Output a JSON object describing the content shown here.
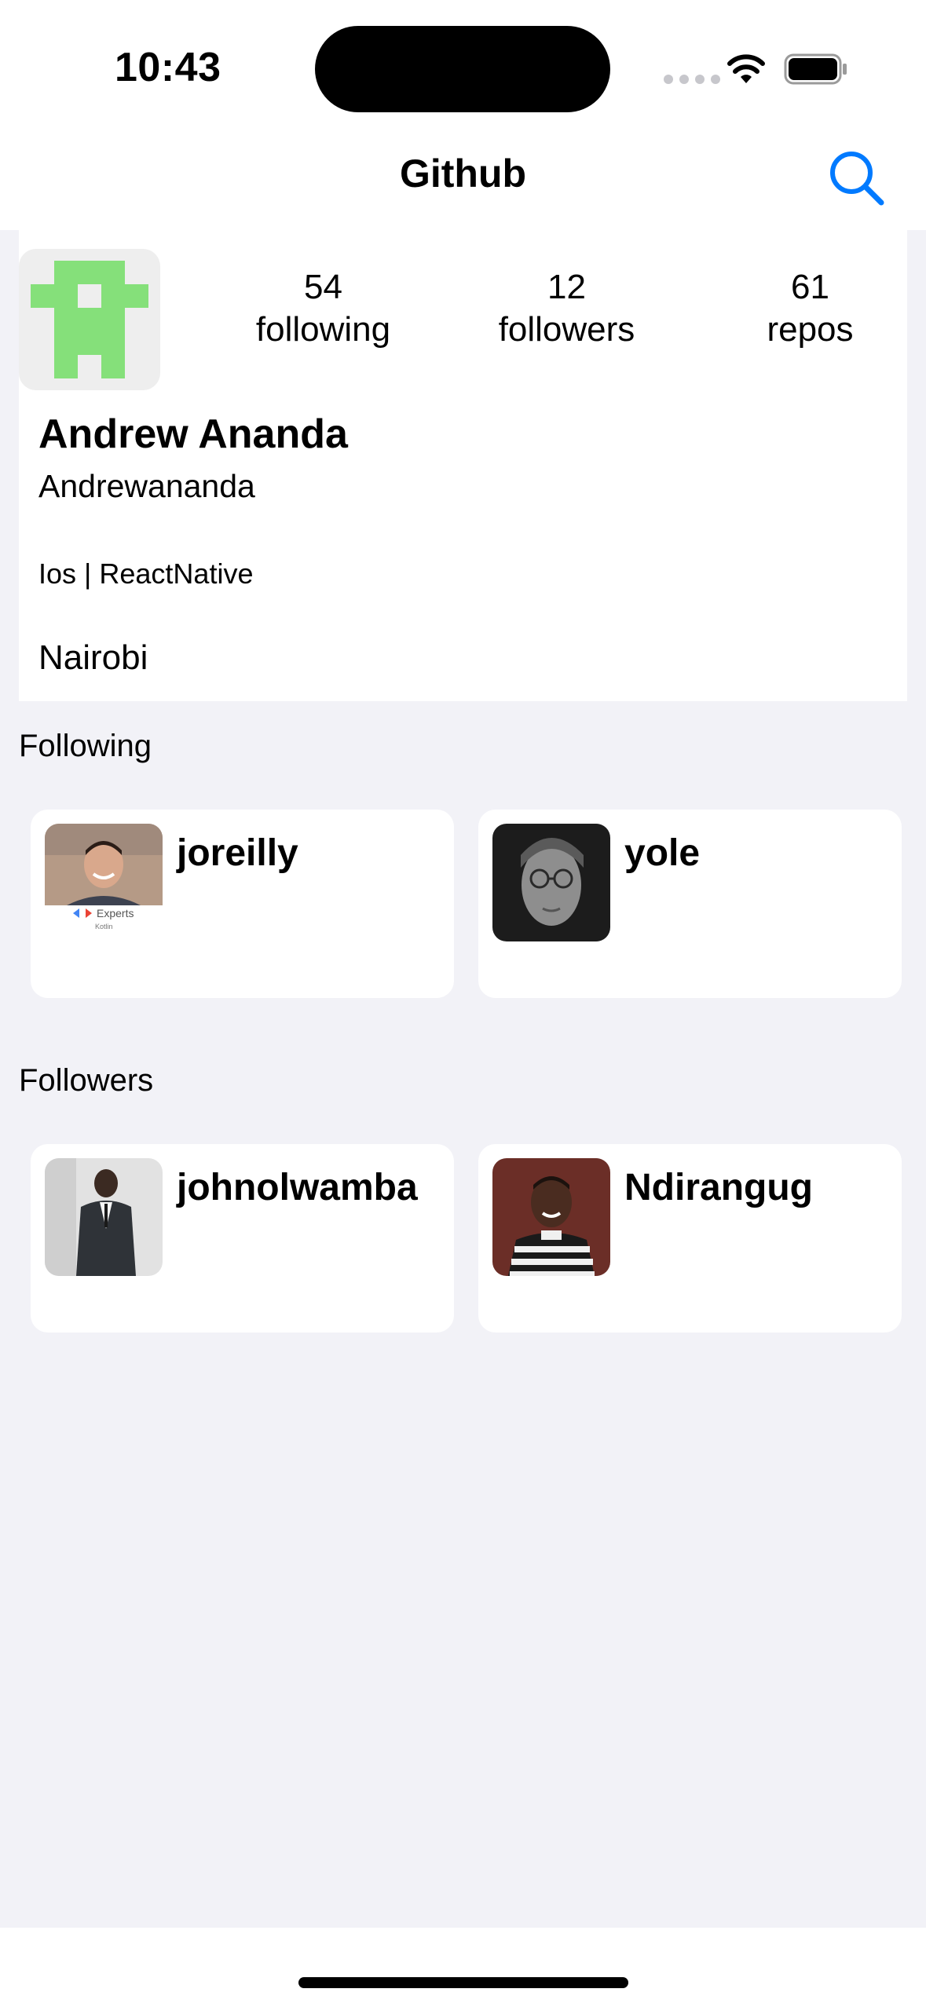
{
  "status_bar": {
    "time": "10:43"
  },
  "nav": {
    "title": "Github",
    "search_icon": "search-icon"
  },
  "profile": {
    "avatar_icon": "identicon",
    "avatar_color": "#85e07a",
    "stats": {
      "following_count": "54",
      "following_label": "following",
      "followers_count": "12",
      "followers_label": "followers",
      "repos_count": "61",
      "repos_label": "repos"
    },
    "name": "Andrew Ananda",
    "login": "Andrewananda",
    "bio": "Ios | ReactNative",
    "location": "Nairobi"
  },
  "following": {
    "title": "Following",
    "users": [
      {
        "name": "joreilly",
        "badge_text": "Experts",
        "badge_sub": "Kotlin"
      },
      {
        "name": "yole"
      }
    ]
  },
  "followers": {
    "title": "Followers",
    "users": [
      {
        "name": "johnolwamba"
      },
      {
        "name": "Ndirangug"
      }
    ]
  },
  "colors": {
    "accent": "#007aff",
    "background": "#f2f2f7",
    "card": "#ffffff"
  }
}
